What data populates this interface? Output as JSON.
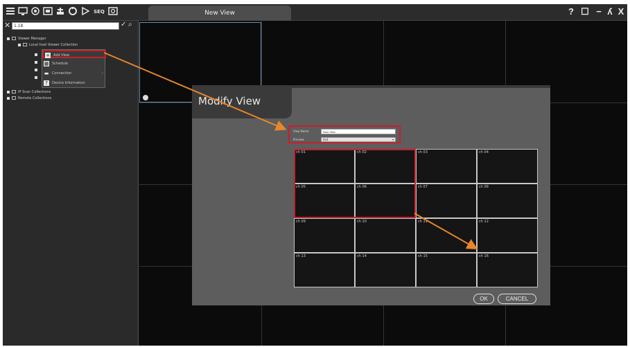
{
  "toolbar": {
    "icons": [
      "menu-icon",
      "monitor-icon",
      "settings-icon",
      "playback-icon",
      "network-icon",
      "record-icon",
      "play-icon",
      "seq-icon",
      "snapshot-icon"
    ],
    "seq_label": "SEQ",
    "window_buttons": {
      "help": "?",
      "maximize": "☐",
      "minimize": "−",
      "user": "ʎ",
      "close": "X"
    }
  },
  "tabs": [
    {
      "label": "New View"
    }
  ],
  "sidebar": {
    "search_value": "1.18",
    "tree": [
      {
        "label": "Viewer Manager"
      },
      {
        "label": "Local host Viewer Collection"
      },
      {
        "label": "IP Scan Collections"
      },
      {
        "label": "Remote Collections"
      }
    ],
    "context_menu": [
      {
        "label": "Add View",
        "icon": "plus-icon"
      },
      {
        "label": "Schedule",
        "icon": "calendar-icon"
      },
      {
        "label": "Connection",
        "icon": "connect-icon"
      },
      {
        "label": "Device Information",
        "icon": "info-icon"
      }
    ]
  },
  "dialog": {
    "title": "Modify View",
    "view_name_label": "View Name",
    "view_name_value": "New View",
    "preview_label": "Preview",
    "preview_value": "4x4",
    "channels": [
      "ch 01",
      "ch 02",
      "ch 03",
      "ch 04",
      "ch 05",
      "ch 06",
      "ch 07",
      "ch 08",
      "ch 09",
      "ch 10",
      "ch 11",
      "ch 12",
      "ch 13",
      "ch 14",
      "ch 15",
      "ch 16"
    ],
    "ok_label": "OK",
    "cancel_label": "CANCEL"
  },
  "colors": {
    "highlight": "#c8202c",
    "arrow": "#e8862a",
    "selected_cell_border": "#6e8fb0"
  }
}
